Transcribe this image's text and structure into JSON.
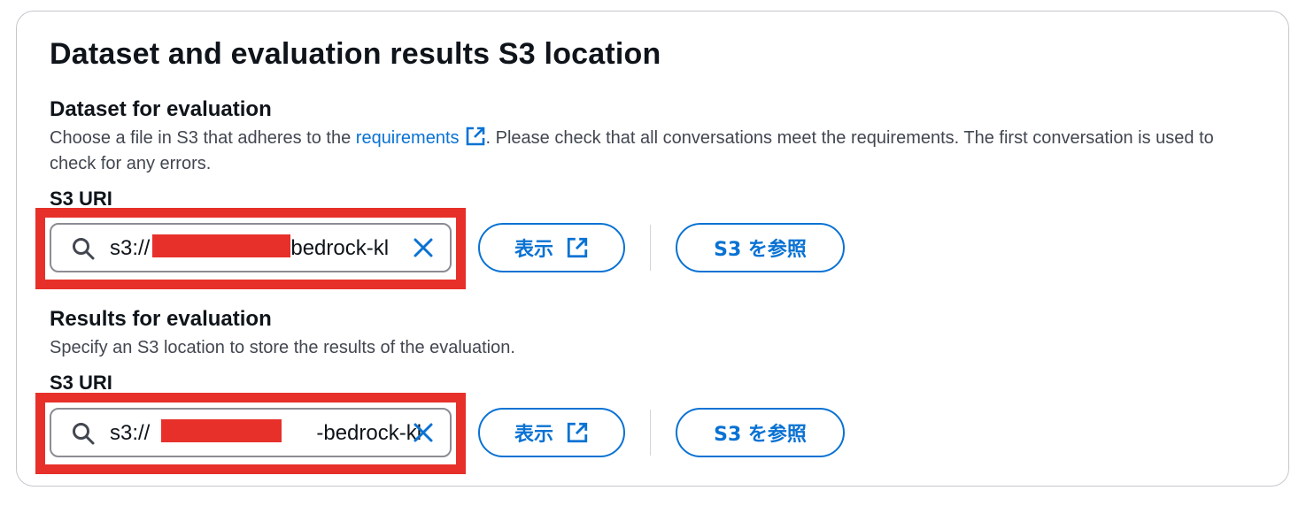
{
  "panel": {
    "title": "Dataset and evaluation results S3 location"
  },
  "dataset": {
    "label": "Dataset for evaluation",
    "desc_before_link": "Choose a file in S3 that adheres to the ",
    "link_text": "requirements",
    "desc_after_link": ". Please check that all conversations meet the requirements. The first conversation is used to check for any errors.",
    "uri_label": "S3 URI",
    "uri_prefix": "s3://",
    "uri_suffix": "bedrock-kl",
    "view_button": "表示",
    "browse_button": "S3 を参照"
  },
  "results": {
    "label": "Results for evaluation",
    "desc": "Specify an S3 location to store the results of the evaluation.",
    "uri_label": "S3 URI",
    "uri_prefix": "s3://",
    "uri_suffix": "-bedrock-kl",
    "view_button": "表示",
    "browse_button": "S3 を参照"
  },
  "colors": {
    "accent": "#0972d3",
    "redaction": "#e7302a",
    "text": "#0f141a",
    "muted": "#424650"
  },
  "icons": [
    "search-icon",
    "clear-icon",
    "external-link-icon"
  ]
}
